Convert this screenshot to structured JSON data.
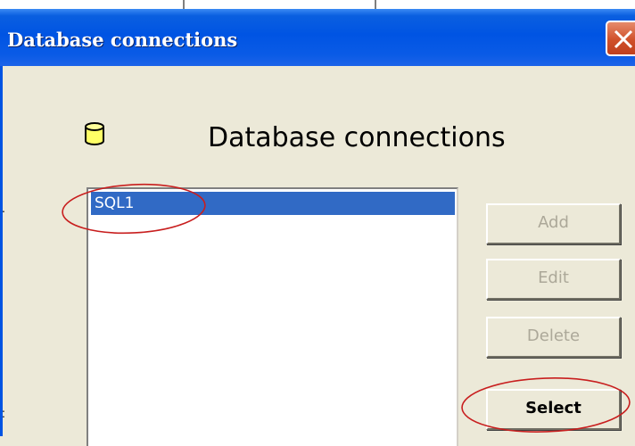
{
  "window": {
    "title": "Database connections",
    "heading": "Database connections"
  },
  "connections": [
    {
      "name": "SQL1",
      "selected": true
    }
  ],
  "buttons": {
    "add": "Add",
    "edit": "Edit",
    "delete": "Delete",
    "select": "Select"
  },
  "icons": {
    "close": "close-icon",
    "database": "database-icon"
  },
  "colors": {
    "titlebar": "#0054e3",
    "selection": "#316ac5",
    "annotation": "#c81e1e",
    "dialog_bg": "#ece9d8"
  }
}
